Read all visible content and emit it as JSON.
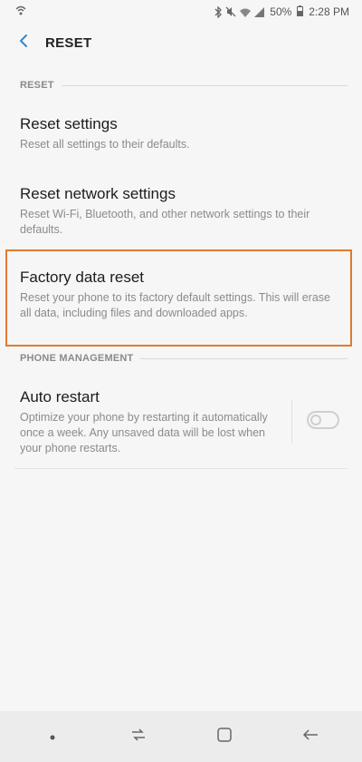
{
  "status_bar": {
    "battery": "50%",
    "time": "2:28 PM",
    "icons": [
      "signal-hotspot-icon",
      "bluetooth-icon",
      "mute-icon",
      "wifi-icon",
      "cell-signal-icon",
      "battery-icon"
    ]
  },
  "app_bar": {
    "back_icon": "chevron-left-icon",
    "title": "RESET"
  },
  "sections": {
    "reset": {
      "header": "RESET",
      "items": [
        {
          "title": "Reset settings",
          "description": "Reset all settings to their defaults."
        },
        {
          "title": "Reset network settings",
          "description": "Reset Wi-Fi, Bluetooth, and other network settings to their defaults."
        },
        {
          "title": "Factory data reset",
          "description": "Reset your phone to its factory default settings. This will erase all data, including files and downloaded apps."
        }
      ]
    },
    "phone_management": {
      "header": "PHONE MANAGEMENT",
      "auto_restart": {
        "title": "Auto restart",
        "description": "Optimize your phone by restarting it automatically once a week. Any unsaved data will be lost when your phone restarts.",
        "enabled": false
      }
    }
  },
  "highlight_color": "#e07a2f",
  "nav_bar": {
    "buttons": [
      "dot-icon",
      "recents-icon",
      "home-icon",
      "back-arrow-icon"
    ]
  }
}
